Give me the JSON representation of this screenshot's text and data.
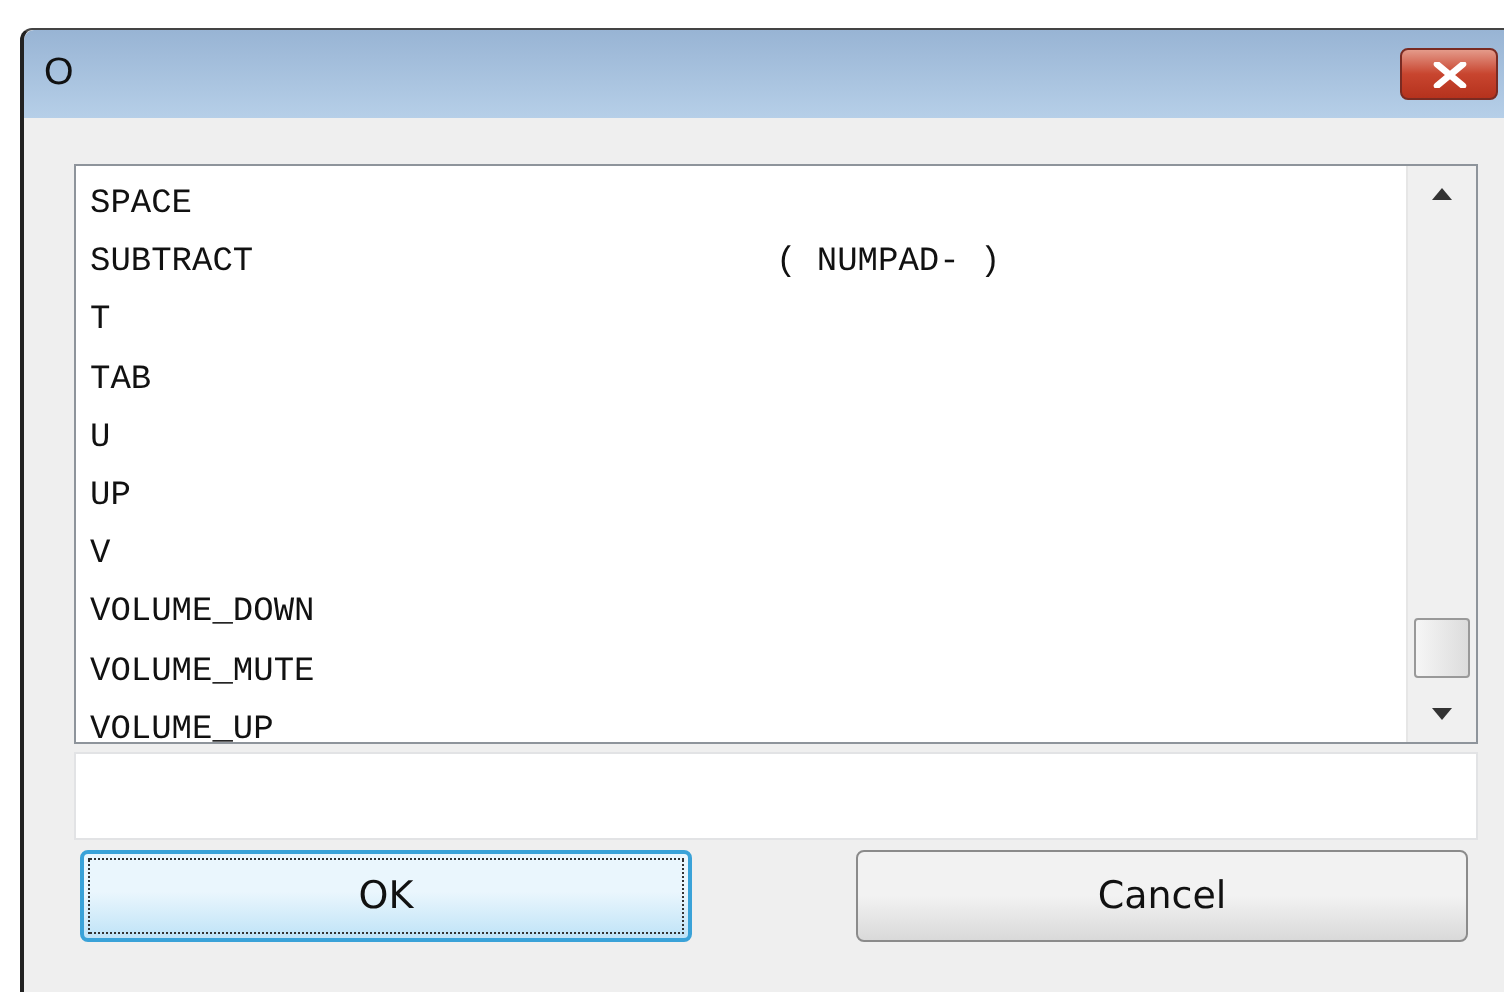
{
  "window": {
    "title": "O"
  },
  "list": {
    "items": [
      {
        "name": "SPACE"
      },
      {
        "name": "SUBTRACT",
        "alias": "( NUMPAD- )"
      },
      {
        "name": "T"
      },
      {
        "name": "TAB"
      },
      {
        "name": "U"
      },
      {
        "name": "UP"
      },
      {
        "name": "V"
      },
      {
        "name": "VOLUME_DOWN"
      },
      {
        "name": "VOLUME_MUTE"
      },
      {
        "name": "VOLUME_UP"
      }
    ]
  },
  "buttons": [
    {
      "label": "OK",
      "kind": "default"
    },
    {
      "label": "Cancel",
      "kind": "normal"
    }
  ]
}
